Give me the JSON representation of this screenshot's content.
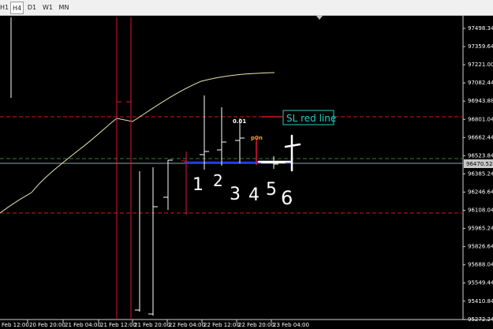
{
  "toolbar": {
    "timeframes": [
      "H1",
      "H4",
      "D1",
      "W1",
      "MN"
    ],
    "active": "H4"
  },
  "price_axis": {
    "labels": [
      "97498.34",
      "97359.64",
      "97221.00",
      "97082.44",
      "96943.88",
      "96801.04",
      "96662.44",
      "96523.84",
      "96385.24",
      "96246.64",
      "96108.04",
      "95965.24",
      "95826.64",
      "95688.04",
      "95549.44",
      "95410.84",
      "95272.24"
    ],
    "current_price": "96470.52"
  },
  "time_axis": {
    "labels": [
      "Feb 12:00",
      "20 Feb 20:00",
      "21 Feb 04:00",
      "21 Feb 12:00",
      "21 Feb 20:00",
      "22 Feb 04:00",
      "22 Feb 12:00",
      "22 Feb 20:00",
      "23 Feb 04:00"
    ]
  },
  "annotations": {
    "sl_label": "SL red line",
    "lot_label": "0.01",
    "order_label": "p0n",
    "sequence": [
      "1",
      "2",
      "3",
      "4",
      "5",
      "6"
    ]
  },
  "colors": {
    "background": "#000000",
    "bull_bar": "#ffffff",
    "bear_bar": "#e0143c",
    "ma_line": "#e8e6b0",
    "sl_line": "#d11a1a",
    "entry_line": "#1f3dff",
    "cyan_label": "#2ec7c9",
    "axis_text": "#ffffff",
    "dashed_green": "#3a7a3a"
  }
}
